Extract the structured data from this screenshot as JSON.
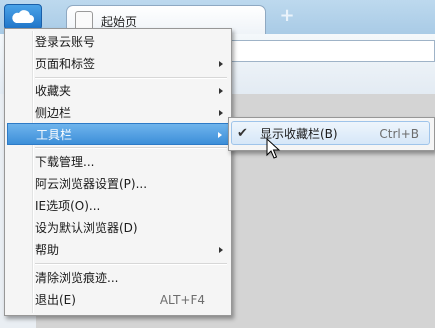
{
  "tab": {
    "label": "起始页"
  },
  "menu": {
    "items": [
      {
        "label": "登录云账号",
        "shortcut": "",
        "submenu": false
      },
      {
        "label": "页面和标签",
        "shortcut": "",
        "submenu": true
      },
      {
        "label": "收藏夹",
        "shortcut": "",
        "submenu": true
      },
      {
        "label": "侧边栏",
        "shortcut": "",
        "submenu": true
      },
      {
        "label": "工具栏",
        "shortcut": "",
        "submenu": true,
        "highlighted": true
      },
      {
        "label": "下载管理...",
        "shortcut": "",
        "submenu": false
      },
      {
        "label": "阿云浏览器设置(P)...",
        "shortcut": "",
        "submenu": false
      },
      {
        "label": "IE选项(O)...",
        "shortcut": "",
        "submenu": false
      },
      {
        "label": "设为默认浏览器(D)",
        "shortcut": "",
        "submenu": false
      },
      {
        "label": "帮助",
        "shortcut": "",
        "submenu": true
      },
      {
        "label": "清除浏览痕迹...",
        "shortcut": "",
        "submenu": false
      },
      {
        "label": "退出(E)",
        "shortcut": "ALT+F4",
        "submenu": false
      }
    ]
  },
  "submenu": {
    "items": [
      {
        "label": "显示收藏栏(B)",
        "shortcut": "Ctrl+B",
        "checked": true
      }
    ]
  },
  "colors": {
    "accent": "#3d8fd9",
    "chrome": "#a9cbe6"
  },
  "icons": {
    "app_button": "cloud-icon",
    "check": "checkmark-icon",
    "new_tab": "plus-icon"
  }
}
